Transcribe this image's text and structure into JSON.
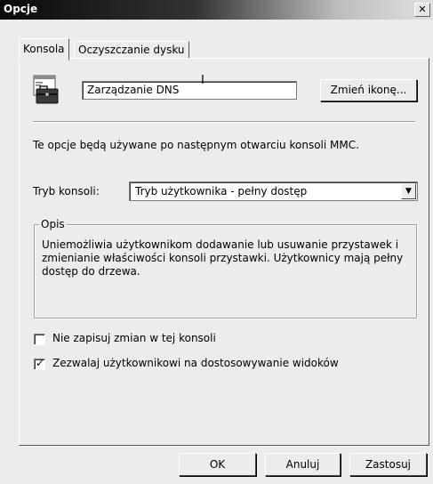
{
  "window": {
    "title": "Opcje",
    "close_glyph": "✕"
  },
  "tabs": [
    {
      "label": "Konsola",
      "active": true
    },
    {
      "label": "Oczyszczanie dysku",
      "active": false
    }
  ],
  "console": {
    "icon": "toolbox-window-icon",
    "name_value": "Zarządzanie DNS",
    "change_icon_button": "Zmień ikonę...",
    "info_text": "Te opcje będą używane po następnym otwarciu konsoli MMC.",
    "mode_label": "Tryb konsoli:",
    "mode_value": "Tryb użytkownika - pełny dostęp",
    "description_legend": "Opis",
    "description_lines": [
      "Uniemożliwia użytkownikom dodawanie lub usuwanie przystawek i",
      "zmienianie właściwości konsoli przystawki. Użytkownicy mają pełny",
      "dostęp do drzewa."
    ],
    "checkbox_no_save": {
      "label": "Nie zapisuj zmian w tej konsoli",
      "checked": false
    },
    "checkbox_customize": {
      "label": "Zezwalaj użytkownikowi na dostosowywanie widoków",
      "checked": true
    }
  },
  "buttons": {
    "ok": "OK",
    "cancel": "Anuluj",
    "apply": "Zastosuj"
  },
  "colors": {
    "face": "#ececec",
    "titlebar_start": "#0a0a0a",
    "titlebar_end": "#e0e0e0"
  }
}
